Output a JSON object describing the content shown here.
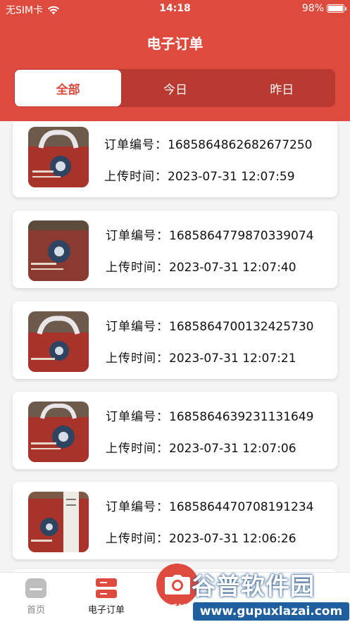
{
  "status_bar": {
    "carrier": "无SIM卡",
    "time": "14:18",
    "battery": "98%",
    "battery_level": 0.98
  },
  "header": {
    "title": "电子订单"
  },
  "tabs": [
    {
      "label": "全部",
      "active": true
    },
    {
      "label": "今日",
      "active": false
    },
    {
      "label": "昨日",
      "active": false
    }
  ],
  "orders": [
    {
      "number_label": "订单编号：",
      "number": "1685864862682677250",
      "time_label": "上传时间：",
      "time": "2023-07-31 12:07:59"
    },
    {
      "number_label": "订单编号：",
      "number": "1685864779870339074",
      "time_label": "上传时间：",
      "time": "2023-07-31 12:07:40"
    },
    {
      "number_label": "订单编号：",
      "number": "1685864700132425730",
      "time_label": "上传时间：",
      "time": "2023-07-31 12:07:21"
    },
    {
      "number_label": "订单编号：",
      "number": "1685864639231131649",
      "time_label": "上传时间：",
      "time": "2023-07-31 12:07:06"
    },
    {
      "number_label": "订单编号：",
      "number": "1685864470708191234",
      "time_label": "上传时间：",
      "time": "2023-07-31 12:06:26"
    }
  ],
  "tabbar": {
    "home": "首页",
    "orders": "电子订单",
    "sign": "纸签"
  },
  "watermark": {
    "text": "谷普软件园",
    "url": "www.gupuxlazai.com"
  },
  "colors": {
    "brand": "#de4b3e",
    "tab_track": "#b83a31"
  }
}
